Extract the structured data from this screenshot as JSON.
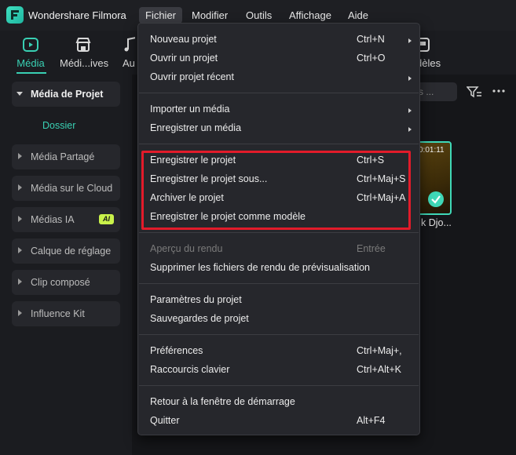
{
  "app": {
    "name": "Wondershare Filmora"
  },
  "menubar": {
    "items": [
      {
        "label": "Fichier"
      },
      {
        "label": "Modifier"
      },
      {
        "label": "Outils"
      },
      {
        "label": "Affichage"
      },
      {
        "label": "Aide"
      }
    ]
  },
  "toolbar": {
    "items": [
      {
        "label": "Média",
        "icon": "media-icon"
      },
      {
        "label": "Médi...ives",
        "icon": "store-icon"
      },
      {
        "label": "Au",
        "icon": "audio-icon"
      },
      {
        "label": "dèles",
        "icon": "templates-icon"
      }
    ]
  },
  "sidebar": {
    "items": [
      {
        "label": "Média de Projet"
      },
      {
        "label": "Média Partagé"
      },
      {
        "label": "Média sur le Cloud"
      },
      {
        "label": "Médias IA",
        "badge": "AI"
      },
      {
        "label": "Calque de réglage"
      },
      {
        "label": "Clip composé"
      },
      {
        "label": "Influence Kit"
      }
    ],
    "subitem": "Dossier"
  },
  "main": {
    "search_placeholder": "s ...",
    "thumbnail": {
      "time": "0:01:11",
      "label": "k Djo..."
    }
  },
  "fichier_menu": {
    "items": [
      {
        "label": "Nouveau projet",
        "shortcut": "Ctrl+N"
      },
      {
        "label": "Ouvrir un projet",
        "shortcut": "Ctrl+O"
      },
      {
        "label": "Ouvrir projet récent",
        "shortcut": ""
      },
      {
        "label": "Importer un média",
        "shortcut": ""
      },
      {
        "label": "Enregistrer un média",
        "shortcut": ""
      },
      {
        "label": "Enregistrer le projet",
        "shortcut": "Ctrl+S"
      },
      {
        "label": "Enregistrer le projet sous...",
        "shortcut": "Ctrl+Maj+S"
      },
      {
        "label": "Archiver le projet",
        "shortcut": "Ctrl+Maj+A"
      },
      {
        "label": "Enregistrer le projet comme modèle",
        "shortcut": ""
      },
      {
        "label": "Aperçu du rendu",
        "shortcut": "Entrée"
      },
      {
        "label": "Supprimer les fichiers de rendu de prévisualisation",
        "shortcut": ""
      },
      {
        "label": "Paramètres du projet",
        "shortcut": ""
      },
      {
        "label": "Sauvegardes de projet",
        "shortcut": ""
      },
      {
        "label": "Préférences",
        "shortcut": "Ctrl+Maj+,"
      },
      {
        "label": "Raccourcis clavier",
        "shortcut": "Ctrl+Alt+K"
      },
      {
        "label": "Retour à la fenêtre de démarrage",
        "shortcut": ""
      },
      {
        "label": "Quitter",
        "shortcut": "Alt+F4"
      }
    ]
  },
  "colors": {
    "accent": "#39d0b3",
    "highlight": "#e21b2a",
    "menu_bg": "#26272c"
  }
}
